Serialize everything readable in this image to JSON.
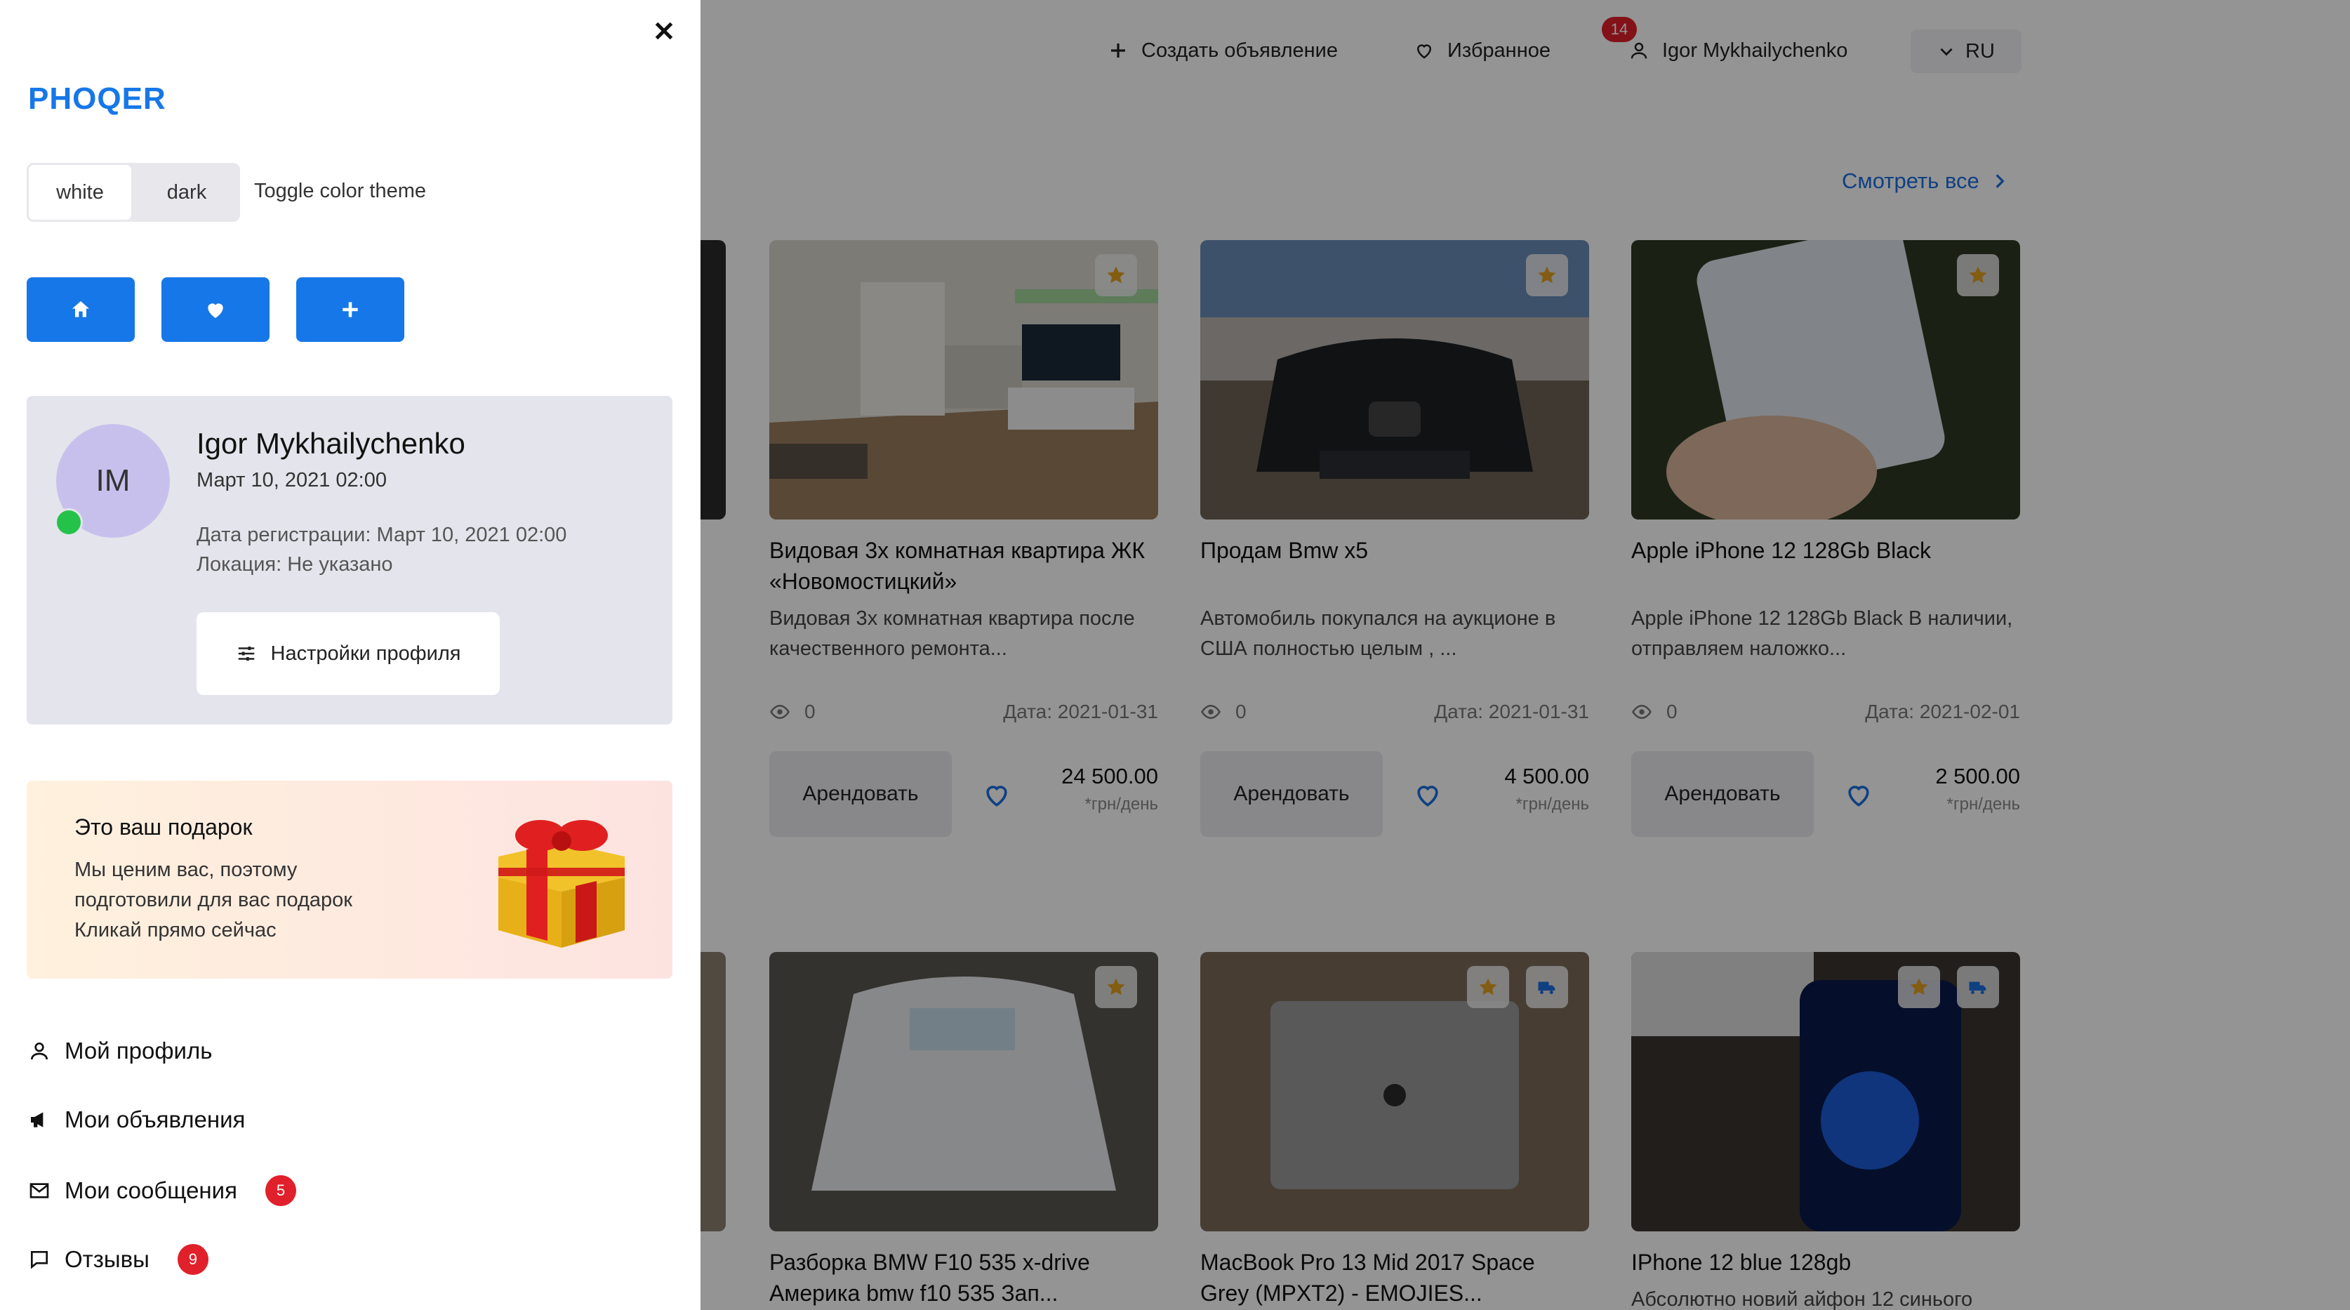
{
  "header": {
    "create_label": "Создать объявление",
    "favorites_label": "Избранное",
    "favorites_count": "14",
    "user_label": "Igor Mykhailychenko",
    "lang_label": "RU"
  },
  "section": {
    "see_all_label": "Смотреть все"
  },
  "cards_row1": [
    {
      "title": "Видовая 3х комнатная квартира ЖК «Новомостицкий»",
      "desc": "Видовая 3х комнатная квартира после качественного ремонта...",
      "views": "0",
      "date": "Дата: 2021-01-31",
      "rent_label": "Арендовать",
      "price": "24 500.00",
      "unit": "*грн/день"
    },
    {
      "title": "Продам Bmw x5",
      "desc": "Автомобиль покупался на аукционе в США полностью целым , ...",
      "views": "0",
      "date": "Дата: 2021-01-31",
      "rent_label": "Арендовать",
      "price": "4 500.00",
      "unit": "*грн/день"
    },
    {
      "title": "Apple iPhone 12 128Gb Black",
      "desc": "Apple iPhone 12 128Gb Black В наличии, отправляем наложко...",
      "views": "0",
      "date": "Дата: 2021-02-01",
      "rent_label": "Арендовать",
      "price": "2 500.00",
      "unit": "*грн/день"
    }
  ],
  "cards_row2": [
    {
      "title": "Разборка BMW F10 535 x-drive Америка bmw f10 535 Зап..."
    },
    {
      "title": "MacBook Pro 13 Mid 2017 Space Grey (MPXT2) - EMOJIES..."
    },
    {
      "title": "IPhone 12 blue 128gb",
      "desc": "Абсолютно новий айфон 12 синього"
    }
  ],
  "drawer": {
    "logo": "PHOQER",
    "theme": {
      "white": "white",
      "dark": "dark",
      "label": "Toggle color theme"
    },
    "profile": {
      "initials": "IM",
      "name": "Igor Mykhailychenko",
      "date": "Март 10, 2021 02:00",
      "registration": "Дата регистрации: Март 10, 2021 02:00",
      "location": "Локация: Не указано",
      "settings_label": "Настройки профиля"
    },
    "gift": {
      "title": "Это ваш подарок",
      "line1": "Мы ценим вас, поэтому",
      "line2": "подготовили для вас подарок",
      "line3": "Кликай прямо сейчас"
    },
    "menu": {
      "profile": "Мой профиль",
      "ads": "Мои объявления",
      "messages": "Мои сообщения",
      "messages_count": "5",
      "reviews": "Отзывы",
      "reviews_count": "9"
    }
  },
  "colors": {
    "accent": "#1677e8",
    "badge": "#e0202a",
    "online": "#25c24a",
    "star": "#e0a020"
  }
}
